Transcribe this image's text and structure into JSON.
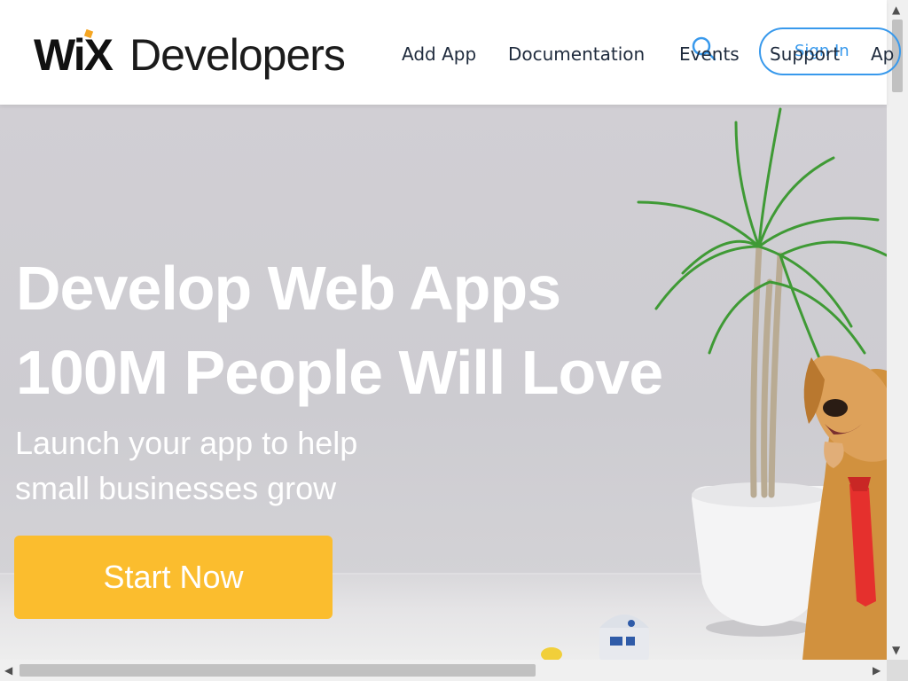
{
  "header": {
    "logo_wix": "WiX",
    "logo_developers": "Developers",
    "nav": [
      "Add App",
      "Documentation",
      "Events",
      "Support"
    ],
    "sign_in": "Sign In",
    "nav_overflow": "Ap"
  },
  "hero": {
    "title_line1": "Develop Web Apps",
    "title_line2": "100M People Will Love",
    "subtitle_line1": "Launch your app to help",
    "subtitle_line2": "small businesses grow",
    "cta": "Start Now"
  },
  "colors": {
    "accent_blue": "#3899ec",
    "cta_yellow": "#fbbd2e",
    "logo_dot": "#f5a623"
  },
  "scrollbars": {
    "up_arrow": "▲",
    "down_arrow": "▼",
    "left_arrow": "◀",
    "right_arrow": "▶"
  }
}
